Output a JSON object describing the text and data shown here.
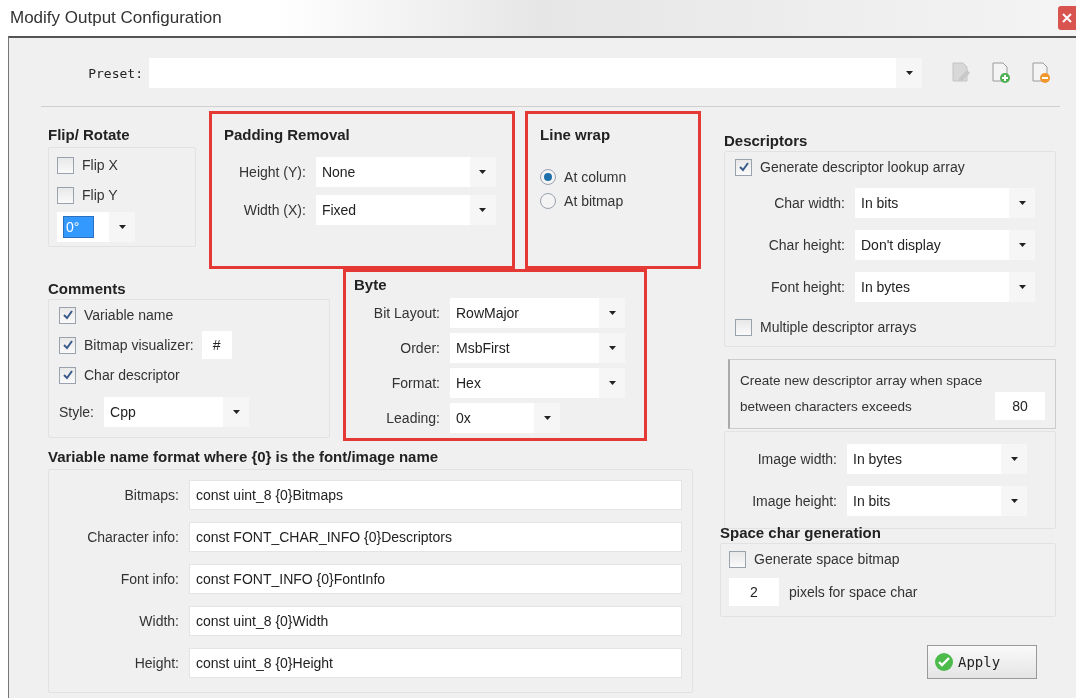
{
  "window": {
    "title": "Modify Output Configuration"
  },
  "preset": {
    "label": "Preset:"
  },
  "flip_rotate": {
    "title": "Flip/ Rotate",
    "options": [
      {
        "label": "Flip X",
        "checked": false
      },
      {
        "label": "Flip Y",
        "checked": false
      }
    ],
    "rotation": {
      "value": "0°"
    }
  },
  "padding_removal": {
    "title": "Padding Removal",
    "highlighted": true,
    "fields": [
      {
        "label": "Height (Y):",
        "value": "None"
      },
      {
        "label": "Width (X):",
        "value": "Fixed"
      }
    ]
  },
  "line_wrap": {
    "title": "Line wrap",
    "highlighted": true,
    "options": [
      {
        "label": "At column",
        "selected": true
      },
      {
        "label": "At bitmap",
        "selected": false
      }
    ]
  },
  "comments": {
    "title": "Comments",
    "options": [
      {
        "label": "Variable name",
        "checked": true
      },
      {
        "label": "Bitmap visualizer:",
        "checked": true,
        "char": "#"
      },
      {
        "label": "Char descriptor",
        "checked": true
      }
    ],
    "style": {
      "label": "Style:",
      "value": "Cpp"
    }
  },
  "byte": {
    "title": "Byte",
    "highlighted": true,
    "fields": [
      {
        "label": "Bit Layout:",
        "value": "RowMajor"
      },
      {
        "label": "Order:",
        "value": "MsbFirst"
      },
      {
        "label": "Format:",
        "value": "Hex"
      },
      {
        "label": "Leading:",
        "value": "0x"
      }
    ]
  },
  "variable_names": {
    "title": "Variable name format where {0} is the font/image name",
    "fields": [
      {
        "label": "Bitmaps:",
        "value": "const uint_8 {0}Bitmaps"
      },
      {
        "label": "Character info:",
        "value": "const FONT_CHAR_INFO {0}Descriptors"
      },
      {
        "label": "Font info:",
        "value": "const FONT_INFO {0}FontInfo"
      },
      {
        "label": "Width:",
        "value": "const uint_8 {0}Width"
      },
      {
        "label": "Height:",
        "value": "const uint_8 {0}Height"
      }
    ]
  },
  "descriptors": {
    "title": "Descriptors",
    "generate_lookup": {
      "label": "Generate descriptor lookup array",
      "checked": true
    },
    "fields": [
      {
        "label": "Char width:",
        "value": "In bits"
      },
      {
        "label": "Char height:",
        "value": "Don't display"
      },
      {
        "label": "Font height:",
        "value": "In bytes"
      }
    ],
    "multiple_arrays": {
      "label": "Multiple descriptor arrays",
      "checked": false
    },
    "threshold": {
      "text": "Create new descriptor array when space between characters exceeds",
      "value": "80"
    },
    "image_fields": [
      {
        "label": "Image width:",
        "value": "In bytes"
      },
      {
        "label": "Image height:",
        "value": "In bits"
      }
    ]
  },
  "space_char": {
    "title": "Space char generation",
    "generate": {
      "label": "Generate space bitmap",
      "checked": false
    },
    "pixels": {
      "value": "2",
      "label": "pixels for space char"
    }
  },
  "apply_button": {
    "label": "Apply"
  }
}
